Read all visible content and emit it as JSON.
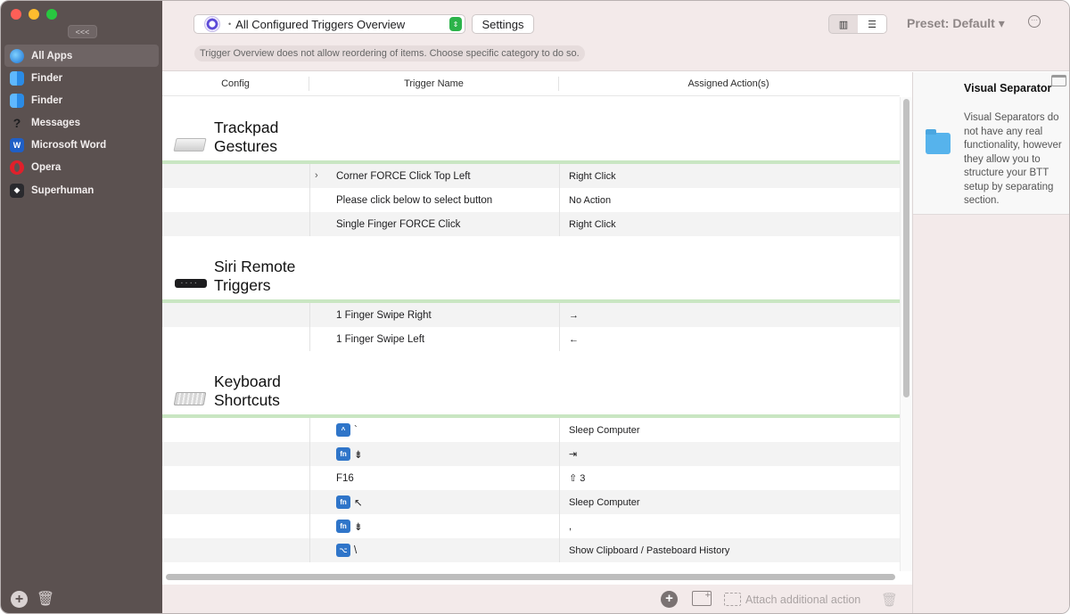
{
  "sidebar": {
    "collapse_label": "<<<",
    "apps": [
      {
        "label": "All Apps",
        "icon": "globe-icon",
        "selected": true
      },
      {
        "label": "Finder",
        "icon": "finder-icon"
      },
      {
        "label": "Finder",
        "icon": "finder-icon"
      },
      {
        "label": "Messages",
        "icon": "question-icon"
      },
      {
        "label": "Microsoft Word",
        "icon": "word-icon"
      },
      {
        "label": "Opera",
        "icon": "opera-icon"
      },
      {
        "label": "Superhuman",
        "icon": "superhuman-icon"
      }
    ],
    "add_label": "+",
    "trash_label": "🗑"
  },
  "toolbar": {
    "trigger_select_value": "All Configured Triggers Overview",
    "trigger_select_dot": "•",
    "stepper_label": "⇕",
    "settings_label": "Settings",
    "preset_label": "Preset: Default ▾",
    "more_label": "···",
    "notice": "Trigger Overview does not allow reordering of items. Choose specific category to do so.",
    "view_columns_label": "▥",
    "view_list_label": "☰"
  },
  "table": {
    "headers": [
      "Config",
      "Trigger Name",
      "Assigned Action(s)"
    ],
    "sections": [
      {
        "title_line1": "Trackpad",
        "title_line2": "Gestures",
        "rows": [
          {
            "chevron": "›",
            "name": "Corner FORCE Click Top Left",
            "action": "Right Click"
          },
          {
            "name": "Please click below to select button",
            "action": "No Action"
          },
          {
            "name": "Single Finger FORCE Click",
            "action": "Right Click"
          }
        ]
      },
      {
        "title_line1": "Siri Remote",
        "title_line2": "Triggers",
        "rows": [
          {
            "name": "1 Finger Swipe Right",
            "action": "→"
          },
          {
            "name": "1 Finger Swipe Left",
            "action": "←"
          }
        ]
      },
      {
        "title_line1": "Keyboard",
        "title_line2": "Shortcuts",
        "rows": [
          {
            "badge": "^",
            "name": "`",
            "action": "Sleep Computer"
          },
          {
            "badge": "fn",
            "name": "⇟",
            "action": "⇥"
          },
          {
            "name": "F16",
            "action": "⇧ 3"
          },
          {
            "badge": "fn",
            "name": "↖",
            "action": "Sleep Computer"
          },
          {
            "badge": "fn",
            "name": "⇟",
            "action": ","
          },
          {
            "badge": "⌥",
            "name": "\\",
            "action": "Show Clipboard / Pasteboard History"
          }
        ]
      }
    ]
  },
  "bottom_bar": {
    "add_label": "+",
    "folder_label": "+",
    "attach_label": "Attach additional action",
    "trash_label": "🗑"
  },
  "right_panel": {
    "title": "Visual Separator",
    "description": "Visual Separators do not have any real functionality, however they allow you to structure your BTT setup by separating section."
  }
}
